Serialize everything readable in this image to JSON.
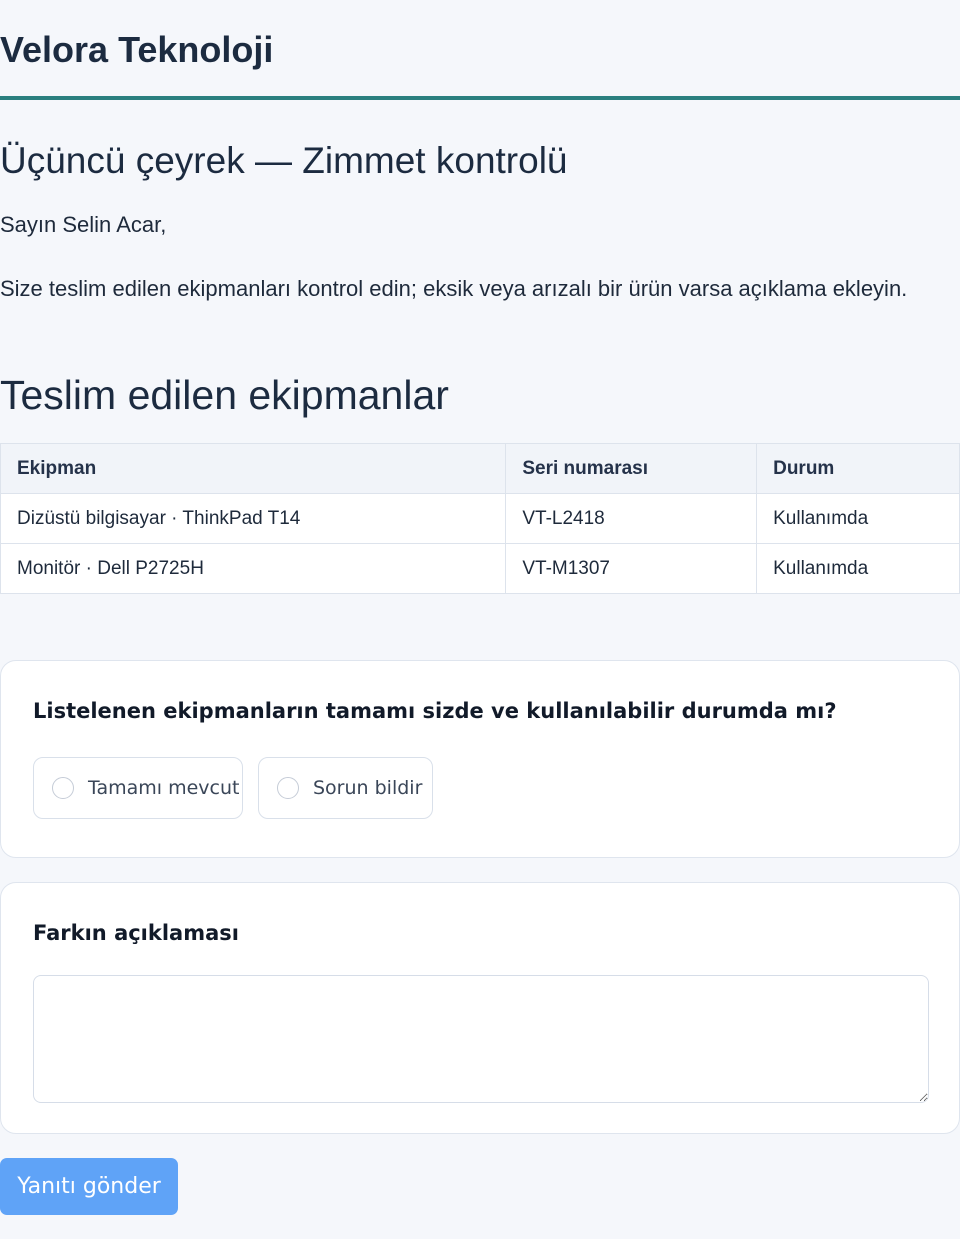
{
  "header": {
    "brand": "Velora Teknoloji",
    "accent_color": "#2a7f7f"
  },
  "main": {
    "title": "Üçüncü çeyrek — Zimmet kontrolü",
    "greeting": "Sayın Selin Acar,",
    "intro": "Size teslim edilen ekipmanları kontrol edin; eksik veya arızalı bir ürün varsa açıklama ekleyin.",
    "section_title": "Teslim edilen ekipmanlar"
  },
  "table": {
    "columns": [
      "Ekipman",
      "Seri numarası",
      "Durum"
    ],
    "rows": [
      [
        "Dizüstü bilgisayar · ThinkPad T14",
        "VT-L2418",
        "Kullanımda"
      ],
      [
        "Monitör · Dell P2725H",
        "VT-M1307",
        "Kullanımda"
      ]
    ]
  },
  "question": {
    "label": "Listelenen ekipmanların tamamı sizde ve kullanılabilir durumda mı?",
    "options": [
      {
        "label": "Tamamı mevcut",
        "selected": false
      },
      {
        "label": "Sorun bildir",
        "selected": false
      }
    ]
  },
  "note": {
    "label": "Farkın açıklaması",
    "value": ""
  },
  "submit": {
    "label": "Yanıtı gönder",
    "color": "#5fa3f7"
  }
}
